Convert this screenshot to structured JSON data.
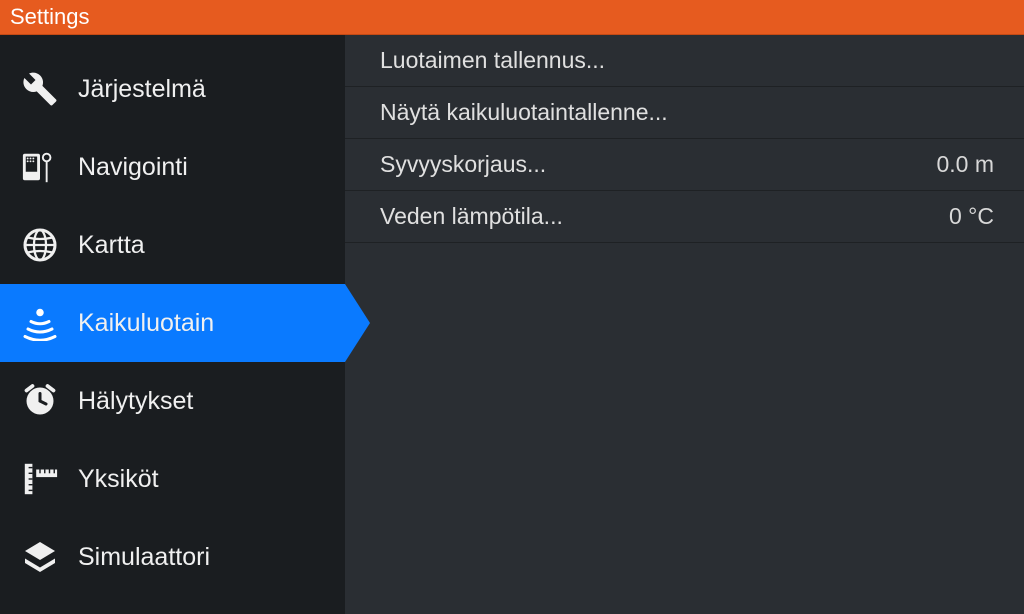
{
  "header": {
    "title": "Settings"
  },
  "sidebar": {
    "items": [
      {
        "label": "Järjestelmä",
        "icon": "wrench",
        "selected": false
      },
      {
        "label": "Navigointi",
        "icon": "navaid",
        "selected": false
      },
      {
        "label": "Kartta",
        "icon": "globe",
        "selected": false
      },
      {
        "label": "Kaikuluotain",
        "icon": "sonar",
        "selected": true
      },
      {
        "label": "Hälytykset",
        "icon": "alarm",
        "selected": false
      },
      {
        "label": "Yksiköt",
        "icon": "ruler",
        "selected": false
      },
      {
        "label": "Simulaattori",
        "icon": "layers",
        "selected": false
      }
    ]
  },
  "content": {
    "items": [
      {
        "label": "Luotaimen tallennus...",
        "value": ""
      },
      {
        "label": "Näytä kaikuluotaintallenne...",
        "value": ""
      },
      {
        "label": "Syvyyskorjaus...",
        "value": "0.0 m"
      },
      {
        "label": "Veden lämpötila...",
        "value": "0 °C"
      }
    ]
  }
}
